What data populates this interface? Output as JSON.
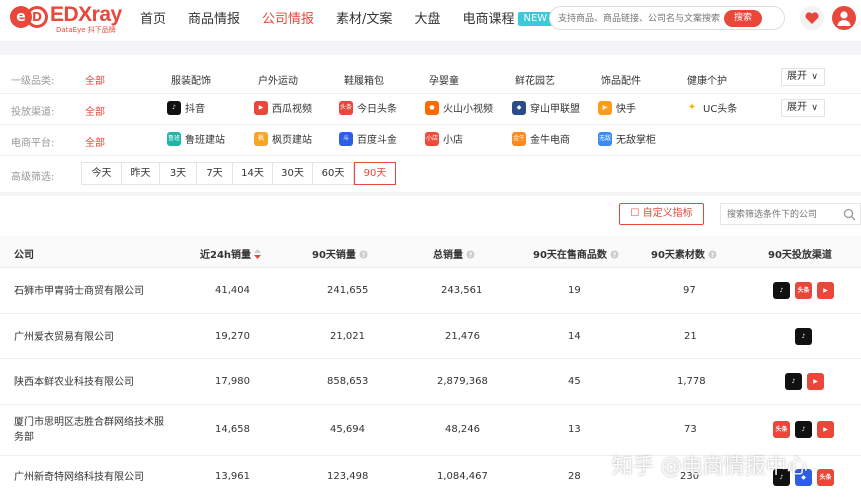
{
  "header": {
    "logo_title": "EDXray",
    "logo_sub": "DataEye 抖下品牌",
    "nav": [
      {
        "label": "首页",
        "active": false
      },
      {
        "label": "商品情报",
        "active": false
      },
      {
        "label": "公司情报",
        "active": true
      },
      {
        "label": "素材/文案",
        "active": false
      },
      {
        "label": "大盘",
        "active": false
      },
      {
        "label": "电商课程",
        "active": false,
        "badge": "NEW"
      }
    ],
    "search_placeholder": "支持商品、商品链接、公司名与文案搜索",
    "search_button": "搜索",
    "accent": "#e8473a"
  },
  "filters": {
    "category": {
      "label": "一级品类:",
      "all": "全部",
      "options": [
        "服装配饰",
        "户外运动",
        "鞋履箱包",
        "孕婴童",
        "鲜花园艺",
        "饰品配件",
        "健康个护"
      ],
      "expand": "展开"
    },
    "channel": {
      "label": "投放渠道:",
      "all": "全部",
      "options": [
        {
          "label": "抖音",
          "icon": "douyin-icon",
          "color": "#111111"
        },
        {
          "label": "西瓜视频",
          "icon": "xigua-icon",
          "color": "#e8473a"
        },
        {
          "label": "今日头条",
          "icon": "toutiao-icon",
          "color": "#e8473a"
        },
        {
          "label": "火山小视频",
          "icon": "huoshan-icon",
          "color": "#ff6a00"
        },
        {
          "label": "穿山甲联盟",
          "icon": "pangle-icon",
          "color": "#2d4a8a"
        },
        {
          "label": "快手",
          "icon": "kuaishou-icon",
          "color": "#ff9c1b"
        },
        {
          "label": "UC头条",
          "icon": "uc-icon",
          "color": "#f5b800"
        }
      ],
      "expand": "展开"
    },
    "platform": {
      "label": "电商平台:",
      "all": "全部",
      "options": [
        {
          "label": "鲁班建站",
          "icon": "luban-icon",
          "color": "#1fb6a8"
        },
        {
          "label": "枫页建站",
          "icon": "fengye-icon",
          "color": "#f5a623"
        },
        {
          "label": "百度斗金",
          "icon": "doujin-icon",
          "color": "#2c5ee8"
        },
        {
          "label": "小店",
          "icon": "xiaodian-icon",
          "color": "#f04b3a"
        },
        {
          "label": "金牛电商",
          "icon": "jinniu-icon",
          "color": "#ff8a1f"
        },
        {
          "label": "无敌掌柜",
          "icon": "wudi-icon",
          "color": "#3b8cf0"
        }
      ]
    },
    "time": {
      "label": "高级筛选:",
      "tabs": [
        "今天",
        "昨天",
        "3天",
        "7天",
        "14天",
        "30天",
        "60天",
        "90天"
      ],
      "active": "90天"
    }
  },
  "table": {
    "custom_button": "自定义指标",
    "search_placeholder": "搜索筛选条件下的公司",
    "columns": [
      "公司",
      "近24h销量",
      "90天销量",
      "总销量",
      "90天在售商品数",
      "90天素材数",
      "90天投放渠道"
    ],
    "rows": [
      {
        "company": "石狮市甲胄骑士商贸有限公司",
        "sales_24h": "41,404",
        "sales_90d": "241,655",
        "total": "243,561",
        "products": "19",
        "materials": "97",
        "channels": [
          "douyin",
          "toutiao",
          "xigua"
        ]
      },
      {
        "company": "广州爱衣贸易有限公司",
        "sales_24h": "19,270",
        "sales_90d": "21,021",
        "total": "21,476",
        "products": "14",
        "materials": "21",
        "channels": [
          "douyin"
        ]
      },
      {
        "company": "陕西本鲜农业科技有限公司",
        "sales_24h": "17,980",
        "sales_90d": "858,653",
        "total": "2,879,368",
        "products": "45",
        "materials": "1,778",
        "channels": [
          "douyin",
          "xigua"
        ]
      },
      {
        "company": "厦门市思明区志胜合群网络技术服务部",
        "sales_24h": "14,658",
        "sales_90d": "45,694",
        "total": "48,246",
        "products": "13",
        "materials": "73",
        "channels": [
          "toutiao",
          "douyin",
          "xigua"
        ]
      },
      {
        "company": "广州新奇特网络科技有限公司",
        "sales_24h": "13,961",
        "sales_90d": "123,498",
        "total": "1,084,467",
        "products": "28",
        "materials": "230",
        "channels": [
          "douyin",
          "pangle",
          "toutiao"
        ]
      }
    ]
  },
  "watermark": "知乎 @电商情报中心"
}
